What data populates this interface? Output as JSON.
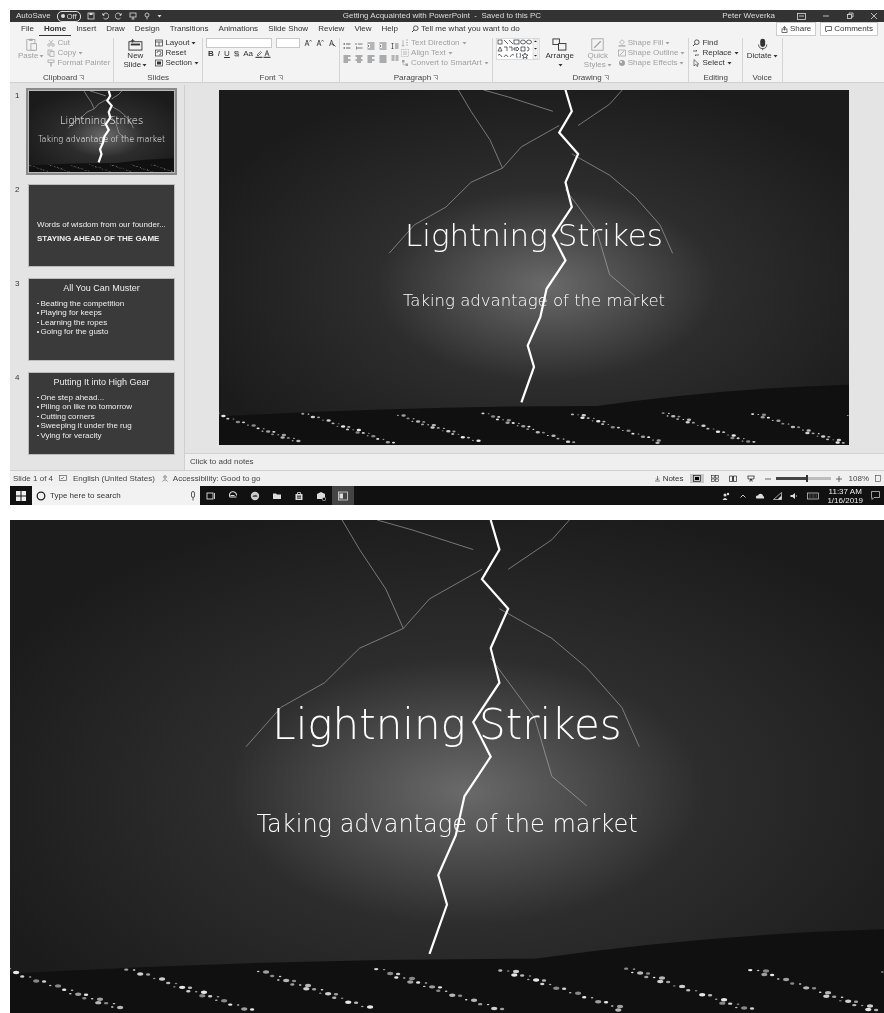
{
  "title_bar": {
    "autosave_label": "AutoSave",
    "autosave_toggle": {
      "label": "Off",
      "on": false
    },
    "title": "Getting Acquainted with PowerPoint  -  Saved to this PC",
    "user": "Peter Weverka"
  },
  "tabs": [
    {
      "label": "File",
      "selected": false
    },
    {
      "label": "Home",
      "selected": true
    },
    {
      "label": "Insert",
      "selected": false
    },
    {
      "label": "Draw",
      "selected": false
    },
    {
      "label": "Design",
      "selected": false
    },
    {
      "label": "Transitions",
      "selected": false
    },
    {
      "label": "Animations",
      "selected": false
    },
    {
      "label": "Slide Show",
      "selected": false
    },
    {
      "label": "Review",
      "selected": false
    },
    {
      "label": "View",
      "selected": false
    },
    {
      "label": "Help",
      "selected": false
    }
  ],
  "tell_me": {
    "placeholder": "Tell me what you want to do"
  },
  "share_button": "Share",
  "comments_button": "Comments",
  "ribbon": [
    {
      "name": "Clipboard",
      "kind": "plain",
      "launcher": true,
      "items": [
        {
          "kind": "large",
          "label": "Paste",
          "disabled": true,
          "dropdown": true
        },
        {
          "kind": "small",
          "label": "Cut",
          "disabled": true,
          "dropdown": false
        },
        {
          "kind": "small",
          "label": "Copy",
          "disabled": true,
          "dropdown": true
        },
        {
          "kind": "small",
          "label": "Format Painter",
          "disabled": true,
          "dropdown": false
        }
      ]
    },
    {
      "name": "Slides",
      "kind": "plain",
      "launcher": false,
      "items": [
        {
          "kind": "large",
          "label": "New Slide",
          "disabled": false,
          "dropdown": true
        },
        {
          "kind": "small",
          "label": "Layout",
          "disabled": false,
          "dropdown": true
        },
        {
          "kind": "small",
          "label": "Reset",
          "disabled": false,
          "dropdown": false
        },
        {
          "kind": "small",
          "label": "Section",
          "disabled": false,
          "dropdown": true
        }
      ]
    },
    {
      "name": "Font",
      "kind": "font",
      "launcher": true,
      "items": [
        {
          "kind": "glyph",
          "label": "B"
        },
        {
          "kind": "glyph",
          "label": "I"
        },
        {
          "kind": "glyph",
          "label": "U"
        },
        {
          "kind": "glyph",
          "label": "S"
        },
        {
          "kind": "glyph",
          "label": "Aa"
        }
      ]
    },
    {
      "name": "Paragraph",
      "kind": "paragraph",
      "launcher": true,
      "items": [
        {
          "kind": "small",
          "label": "Text Direction",
          "disabled": true,
          "dropdown": true
        },
        {
          "kind": "small",
          "label": "Align Text",
          "disabled": true,
          "dropdown": true
        },
        {
          "kind": "small",
          "label": "Convert to SmartArt",
          "disabled": true,
          "dropdown": true
        }
      ]
    },
    {
      "name": "Drawing",
      "kind": "drawing",
      "launcher": true,
      "items": [
        {
          "kind": "large",
          "label": "Arrange",
          "disabled": false,
          "dropdown": true
        },
        {
          "kind": "large",
          "label": "Quick Styles",
          "disabled": true,
          "dropdown": true
        },
        {
          "kind": "small",
          "label": "Shape Fill",
          "disabled": true,
          "dropdown": true
        },
        {
          "kind": "small",
          "label": "Shape Outline",
          "disabled": true,
          "dropdown": true
        },
        {
          "kind": "small",
          "label": "Shape Effects",
          "disabled": true,
          "dropdown": true
        }
      ]
    },
    {
      "name": "Editing",
      "kind": "plain",
      "launcher": false,
      "items": [
        {
          "kind": "small",
          "label": "Find",
          "disabled": false,
          "dropdown": false
        },
        {
          "kind": "small",
          "label": "Replace",
          "disabled": false,
          "dropdown": true
        },
        {
          "kind": "small",
          "label": "Select",
          "disabled": false,
          "dropdown": true
        }
      ]
    },
    {
      "name": "Voice",
      "kind": "plain",
      "launcher": false,
      "items": [
        {
          "kind": "large",
          "label": "Dictate",
          "disabled": false,
          "dropdown": true
        }
      ]
    }
  ],
  "thumbnails": [
    {
      "number": "1",
      "selected": true,
      "kind": "photo",
      "title": "Lightning Strikes",
      "subtitle": "Taking advantage of the market"
    },
    {
      "number": "2",
      "selected": false,
      "kind": "section",
      "kicker": "Words of wisdom from our founder...",
      "title": "STAYING AHEAD OF THE GAME"
    },
    {
      "number": "3",
      "selected": false,
      "kind": "bullets",
      "title": "All You Can Muster",
      "bullets": [
        "Beating the competition",
        "Playing for keeps",
        "Learning the ropes",
        "Going for the gusto"
      ]
    },
    {
      "number": "4",
      "selected": false,
      "kind": "bullets",
      "title": "Putting It into High Gear",
      "bullets": [
        "One step ahead...",
        "Piling on like no tomorrow",
        "Cutting corners",
        "Sweeping it under the rug",
        "Vying for veracity"
      ]
    }
  ],
  "slide": {
    "title": "Lightning Strikes",
    "subtitle": "Taking advantage of the market"
  },
  "notes": {
    "placeholder": "Click to add notes"
  },
  "status_bar": {
    "slide_count": "Slide 1 of 4",
    "language": "English (United States)",
    "accessibility": "Accessibility: Good to go",
    "notes_button": "Notes",
    "views": [
      {
        "selected": true
      },
      {
        "selected": false
      },
      {
        "selected": false
      },
      {
        "selected": false
      }
    ],
    "zoom": {
      "level": 0.58,
      "reading": "108%"
    }
  },
  "taskbar": {
    "search": {
      "placeholder": "Type here to search"
    },
    "apps": [
      {
        "selected": false
      },
      {
        "selected": false
      },
      {
        "selected": false
      },
      {
        "selected": false
      },
      {
        "selected": false
      },
      {
        "selected": false
      },
      {
        "selected": true
      }
    ],
    "time": "11:37 AM",
    "date": "1/16/2019"
  },
  "slideshow": {
    "title": "Lightning Strikes",
    "subtitle": "Taking advantage of the market"
  }
}
